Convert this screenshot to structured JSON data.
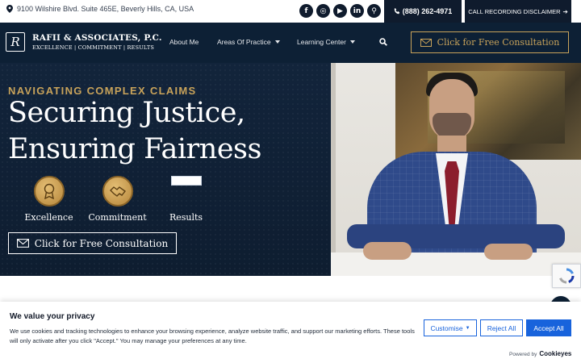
{
  "topbar": {
    "address": "9100 Wilshire Blvd. Suite 465E, Beverly Hills, CA, USA",
    "socials": [
      {
        "icon": "facebook-icon",
        "glyph": "f"
      },
      {
        "icon": "instagram-icon",
        "glyph": "◎"
      },
      {
        "icon": "youtube-icon",
        "glyph": "▶"
      },
      {
        "icon": "linkedin-icon",
        "glyph": "in"
      },
      {
        "icon": "location-icon",
        "glyph": "⚲"
      }
    ],
    "phone": "(888) 262-4971",
    "disclaimer": "CALL RECORDING DISCLAIMER"
  },
  "nav": {
    "logo_mark": "R",
    "logo_name": "RAFII & ASSOCIATES, P.C.",
    "logo_tagline": "EXCELLENCE | COMMITMENT | RESULTS",
    "items": [
      {
        "label": "About Me",
        "has_caret": false
      },
      {
        "label": "Areas Of Practice",
        "has_caret": true
      },
      {
        "label": "Learning Center",
        "has_caret": true
      }
    ],
    "cta": "Click for Free Consultation"
  },
  "hero": {
    "eyebrow": "NAVIGATING COMPLEX CLAIMS",
    "headline_1": "Securing Justice,",
    "headline_2": "Ensuring Fairness",
    "values": [
      {
        "label": "Excellence",
        "icon": "award-ribbon-icon"
      },
      {
        "label": "Commitment",
        "icon": "handshake-icon"
      },
      {
        "label": "Results",
        "icon": "broken-image-icon"
      }
    ],
    "cta": "Click for Free Consultation"
  },
  "cookie": {
    "title": "We value your privacy",
    "text": "We use cookies and tracking technologies to enhance your browsing experience, analyze website traffic, and support our marketing efforts. These tools will only activate after you click \"Accept.\" You may manage your preferences at any time.",
    "customise": "Customise",
    "reject": "Reject All",
    "accept": "Accept All",
    "powered_by": "Powered by",
    "brand": "Cookieyes"
  },
  "colors": {
    "navy": "#0d2035",
    "gold": "#c9a35a",
    "cookie_blue": "#1863dc"
  }
}
